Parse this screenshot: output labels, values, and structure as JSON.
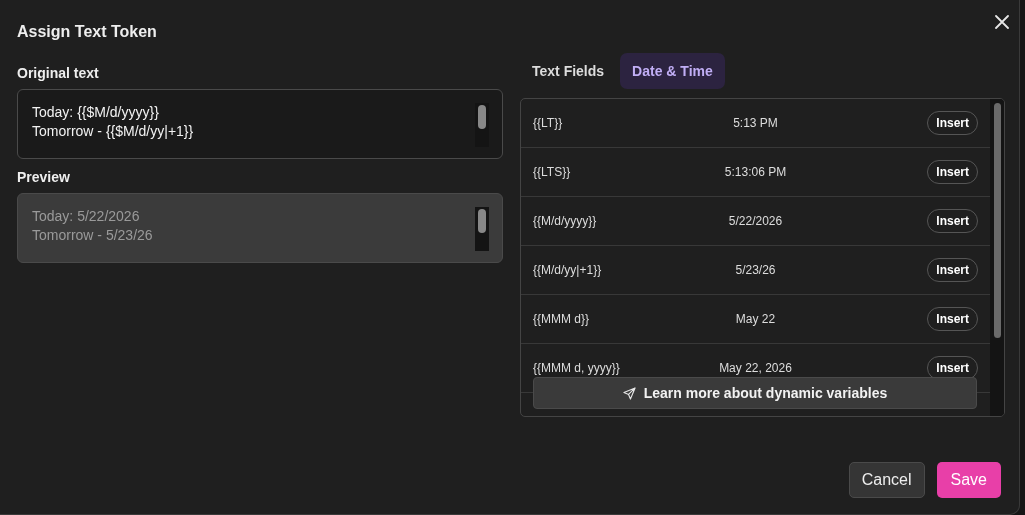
{
  "dialog": {
    "title": "Assign Text Token"
  },
  "original_text": {
    "label": "Original text",
    "lines": [
      "Today: {{$M/d/yyyy}}",
      "Tomorrow - {{$M/d/yy|+1}}"
    ]
  },
  "preview": {
    "label": "Preview",
    "lines": [
      "Today: 5/22/2026",
      "Tomorrow - 5/23/26"
    ],
    "disabled": true
  },
  "tabs": [
    {
      "label": "Text Fields",
      "selected": false
    },
    {
      "label": "Date & Time",
      "selected": true
    }
  ],
  "tokens": [
    {
      "token": "{{LT}}",
      "value": "5:13 PM",
      "action": "Insert"
    },
    {
      "token": "{{LTS}}",
      "value": "5:13:06 PM",
      "action": "Insert"
    },
    {
      "token": "{{M/d/yyyy}}",
      "value": "5/22/2026",
      "action": "Insert"
    },
    {
      "token": "{{M/d/yy|+1}}",
      "value": "5/23/26",
      "action": "Insert"
    },
    {
      "token": "{{MMM d}}",
      "value": "May 22",
      "action": "Insert"
    },
    {
      "token": "{{MMM d, yyyy}}",
      "value": "May 22, 2026",
      "action": "Insert"
    }
  ],
  "learn_more": "Learn more about dynamic variables",
  "buttons": [
    {
      "label": "Cancel",
      "kind": "secondary"
    },
    {
      "label": "Save",
      "kind": "primary"
    }
  ]
}
